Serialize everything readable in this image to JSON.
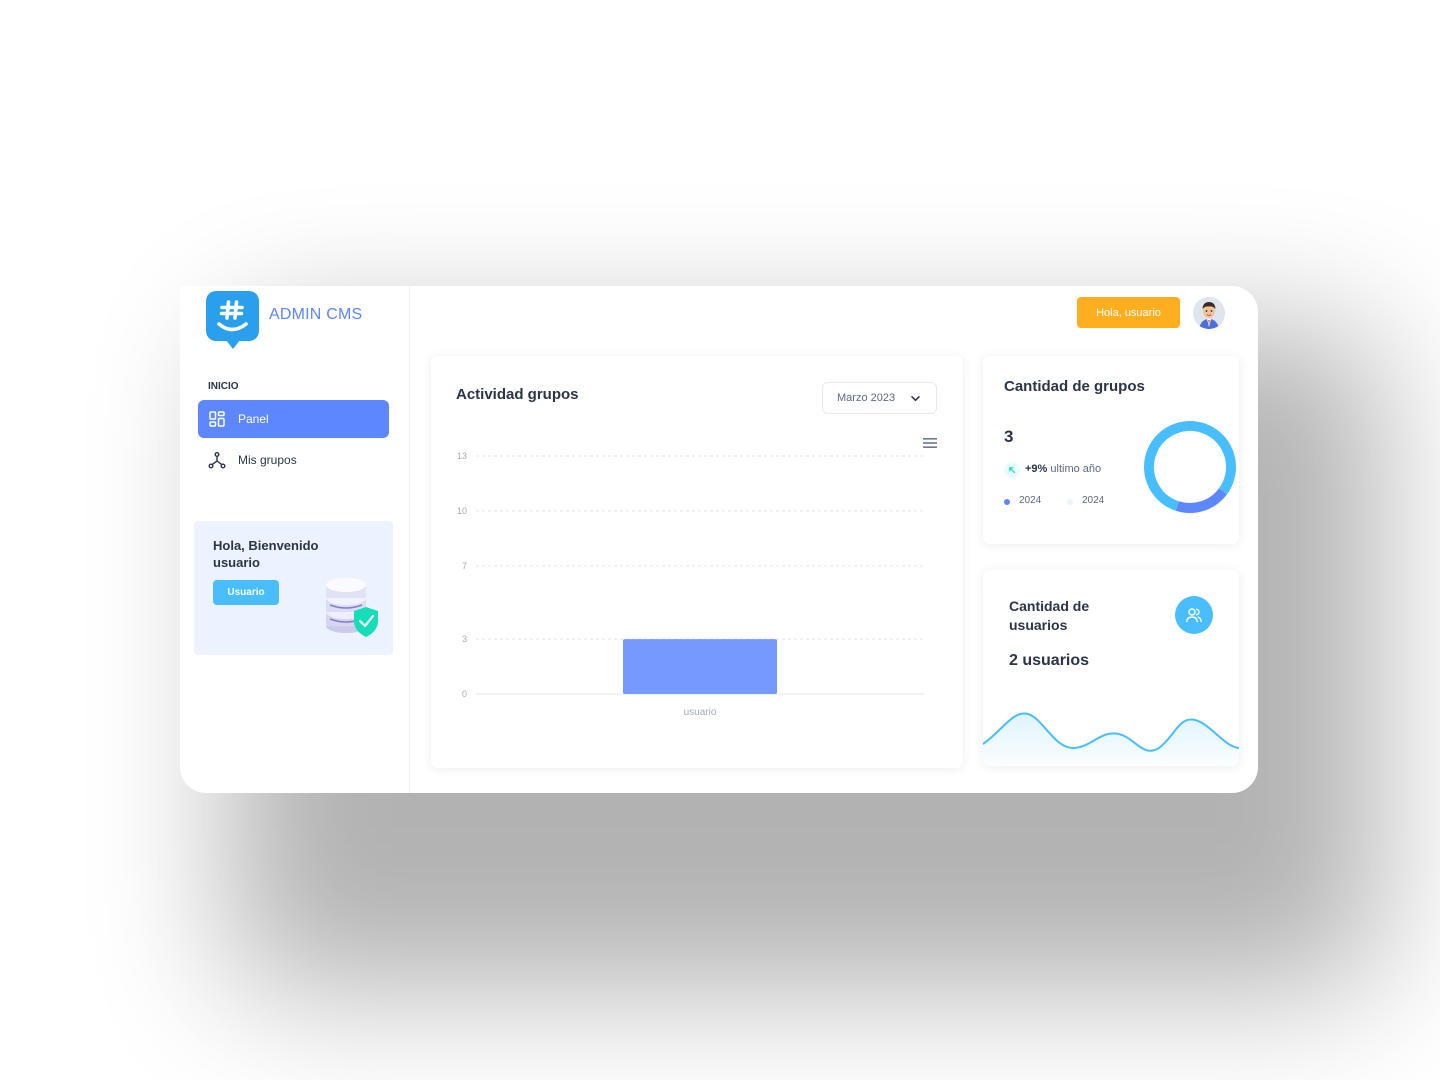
{
  "sidebar": {
    "brand": "ADMIN CMS",
    "section_label": "INICIO",
    "items": [
      {
        "label": "Panel",
        "icon": "dashboard-icon",
        "active": true
      },
      {
        "label": "Mis grupos",
        "icon": "network-icon",
        "active": false
      }
    ],
    "welcome_card": {
      "title": "Hola, Bienvenido usuario",
      "button_label": "Usuario"
    }
  },
  "header": {
    "greeting_button": "Hola, usuario"
  },
  "activity_card": {
    "title": "Actividad grupos",
    "month_select": "Marzo 2023"
  },
  "groups_card": {
    "title": "Cantidad de grupos",
    "count": "3",
    "growth_value": "+9%",
    "growth_label": "ultimo año",
    "legend": [
      {
        "label": "2024",
        "color": "#5d87ff"
      },
      {
        "label": "2024",
        "color": "#ecf2ff"
      }
    ]
  },
  "users_card": {
    "title": "Cantidad de usuarios",
    "count": "2 usuarios"
  },
  "colors": {
    "primary": "#5d87ff",
    "secondary": "#49beff",
    "warning": "#ffae1f",
    "bar": "#7599ff"
  },
  "chart_data": [
    {
      "type": "bar",
      "categories": [
        "usuario"
      ],
      "values": [
        3
      ],
      "yticks": [
        "0",
        "3",
        "7",
        "10",
        "13"
      ],
      "ylim": [
        0,
        13
      ],
      "grid": true
    },
    {
      "type": "pie",
      "categories": [
        "2024",
        "2024"
      ],
      "values": [
        80,
        20
      ]
    }
  ]
}
